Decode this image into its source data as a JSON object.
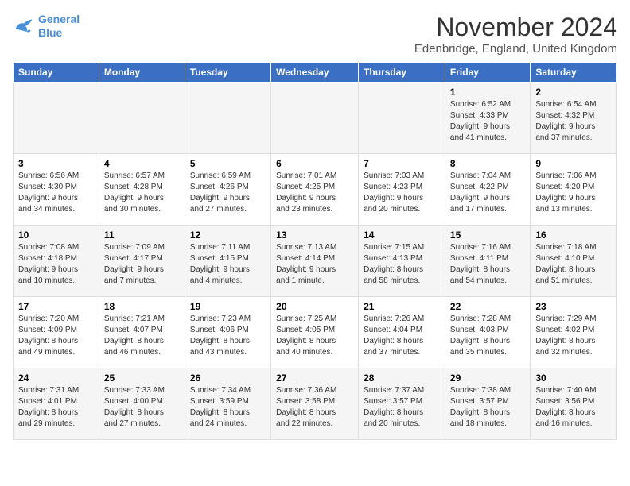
{
  "header": {
    "logo_line1": "General",
    "logo_line2": "Blue",
    "title": "November 2024",
    "subtitle": "Edenbridge, England, United Kingdom"
  },
  "weekdays": [
    "Sunday",
    "Monday",
    "Tuesday",
    "Wednesday",
    "Thursday",
    "Friday",
    "Saturday"
  ],
  "weeks": [
    [
      {
        "day": "",
        "info": ""
      },
      {
        "day": "",
        "info": ""
      },
      {
        "day": "",
        "info": ""
      },
      {
        "day": "",
        "info": ""
      },
      {
        "day": "",
        "info": ""
      },
      {
        "day": "1",
        "info": "Sunrise: 6:52 AM\nSunset: 4:33 PM\nDaylight: 9 hours\nand 41 minutes."
      },
      {
        "day": "2",
        "info": "Sunrise: 6:54 AM\nSunset: 4:32 PM\nDaylight: 9 hours\nand 37 minutes."
      }
    ],
    [
      {
        "day": "3",
        "info": "Sunrise: 6:56 AM\nSunset: 4:30 PM\nDaylight: 9 hours\nand 34 minutes."
      },
      {
        "day": "4",
        "info": "Sunrise: 6:57 AM\nSunset: 4:28 PM\nDaylight: 9 hours\nand 30 minutes."
      },
      {
        "day": "5",
        "info": "Sunrise: 6:59 AM\nSunset: 4:26 PM\nDaylight: 9 hours\nand 27 minutes."
      },
      {
        "day": "6",
        "info": "Sunrise: 7:01 AM\nSunset: 4:25 PM\nDaylight: 9 hours\nand 23 minutes."
      },
      {
        "day": "7",
        "info": "Sunrise: 7:03 AM\nSunset: 4:23 PM\nDaylight: 9 hours\nand 20 minutes."
      },
      {
        "day": "8",
        "info": "Sunrise: 7:04 AM\nSunset: 4:22 PM\nDaylight: 9 hours\nand 17 minutes."
      },
      {
        "day": "9",
        "info": "Sunrise: 7:06 AM\nSunset: 4:20 PM\nDaylight: 9 hours\nand 13 minutes."
      }
    ],
    [
      {
        "day": "10",
        "info": "Sunrise: 7:08 AM\nSunset: 4:18 PM\nDaylight: 9 hours\nand 10 minutes."
      },
      {
        "day": "11",
        "info": "Sunrise: 7:09 AM\nSunset: 4:17 PM\nDaylight: 9 hours\nand 7 minutes."
      },
      {
        "day": "12",
        "info": "Sunrise: 7:11 AM\nSunset: 4:15 PM\nDaylight: 9 hours\nand 4 minutes."
      },
      {
        "day": "13",
        "info": "Sunrise: 7:13 AM\nSunset: 4:14 PM\nDaylight: 9 hours\nand 1 minute."
      },
      {
        "day": "14",
        "info": "Sunrise: 7:15 AM\nSunset: 4:13 PM\nDaylight: 8 hours\nand 58 minutes."
      },
      {
        "day": "15",
        "info": "Sunrise: 7:16 AM\nSunset: 4:11 PM\nDaylight: 8 hours\nand 54 minutes."
      },
      {
        "day": "16",
        "info": "Sunrise: 7:18 AM\nSunset: 4:10 PM\nDaylight: 8 hours\nand 51 minutes."
      }
    ],
    [
      {
        "day": "17",
        "info": "Sunrise: 7:20 AM\nSunset: 4:09 PM\nDaylight: 8 hours\nand 49 minutes."
      },
      {
        "day": "18",
        "info": "Sunrise: 7:21 AM\nSunset: 4:07 PM\nDaylight: 8 hours\nand 46 minutes."
      },
      {
        "day": "19",
        "info": "Sunrise: 7:23 AM\nSunset: 4:06 PM\nDaylight: 8 hours\nand 43 minutes."
      },
      {
        "day": "20",
        "info": "Sunrise: 7:25 AM\nSunset: 4:05 PM\nDaylight: 8 hours\nand 40 minutes."
      },
      {
        "day": "21",
        "info": "Sunrise: 7:26 AM\nSunset: 4:04 PM\nDaylight: 8 hours\nand 37 minutes."
      },
      {
        "day": "22",
        "info": "Sunrise: 7:28 AM\nSunset: 4:03 PM\nDaylight: 8 hours\nand 35 minutes."
      },
      {
        "day": "23",
        "info": "Sunrise: 7:29 AM\nSunset: 4:02 PM\nDaylight: 8 hours\nand 32 minutes."
      }
    ],
    [
      {
        "day": "24",
        "info": "Sunrise: 7:31 AM\nSunset: 4:01 PM\nDaylight: 8 hours\nand 29 minutes."
      },
      {
        "day": "25",
        "info": "Sunrise: 7:33 AM\nSunset: 4:00 PM\nDaylight: 8 hours\nand 27 minutes."
      },
      {
        "day": "26",
        "info": "Sunrise: 7:34 AM\nSunset: 3:59 PM\nDaylight: 8 hours\nand 24 minutes."
      },
      {
        "day": "27",
        "info": "Sunrise: 7:36 AM\nSunset: 3:58 PM\nDaylight: 8 hours\nand 22 minutes."
      },
      {
        "day": "28",
        "info": "Sunrise: 7:37 AM\nSunset: 3:57 PM\nDaylight: 8 hours\nand 20 minutes."
      },
      {
        "day": "29",
        "info": "Sunrise: 7:38 AM\nSunset: 3:57 PM\nDaylight: 8 hours\nand 18 minutes."
      },
      {
        "day": "30",
        "info": "Sunrise: 7:40 AM\nSunset: 3:56 PM\nDaylight: 8 hours\nand 16 minutes."
      }
    ]
  ]
}
